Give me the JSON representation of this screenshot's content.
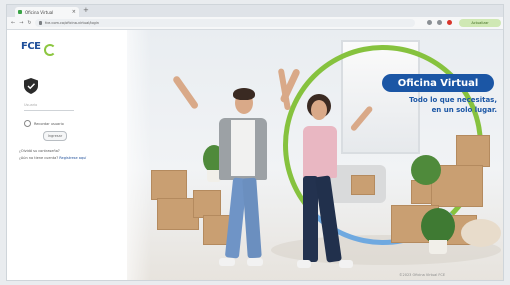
{
  "browser": {
    "tab_title": "Oficina Virtual",
    "url": "fce.com.co/oficina-virtual/login",
    "profile_label": "Actualizar"
  },
  "login": {
    "logo_text": "FCE",
    "user_placeholder": "Usuario",
    "remember_label": "Recordar usuario",
    "login_button": "Ingresar",
    "forgot_link": "¿Olvidó su contraseña?",
    "register_prefix": "¿Aún no tiene cuenta?",
    "register_link": "Regístrese aquí"
  },
  "hero": {
    "banner_title": "Oficina Virtual",
    "tagline_line1": "Todo lo que necesitas,",
    "tagline_line2": "en un solo lugar.",
    "footer_text": "©2023 Oficina Virtual FCE"
  },
  "colors": {
    "brand_blue": "#1b56a5",
    "brand_green": "#86c23e"
  },
  "icons": {
    "shield": "shield-check-icon",
    "lock": "lock-icon"
  }
}
